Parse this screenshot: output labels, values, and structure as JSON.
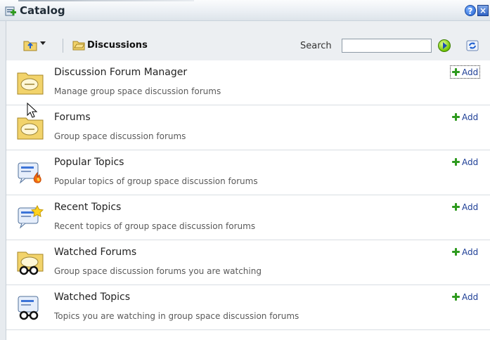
{
  "window": {
    "title": "Catalog",
    "help_icon": "help-icon",
    "close_icon": "close-icon",
    "help_glyph": "?",
    "close_glyph": "×"
  },
  "toolbar": {
    "breadcrumb": "Discussions",
    "search_label": "Search",
    "search_value": "",
    "search_placeholder": ""
  },
  "items": [
    {
      "title": "Discussion Forum Manager",
      "description": "Manage group space discussion forums",
      "add_label": "Add",
      "icon": "folder-discussion-icon"
    },
    {
      "title": "Forums",
      "description": "Group space discussion forums",
      "add_label": "Add",
      "icon": "folder-discussion-icon"
    },
    {
      "title": "Popular Topics",
      "description": "Popular topics of group space discussion forums",
      "add_label": "Add",
      "icon": "popular-topics-icon"
    },
    {
      "title": "Recent Topics",
      "description": "Recent topics of group space discussion forums",
      "add_label": "Add",
      "icon": "recent-topics-icon"
    },
    {
      "title": "Watched Forums",
      "description": "Group space discussion forums you are watching",
      "add_label": "Add",
      "icon": "watched-forums-icon"
    },
    {
      "title": "Watched Topics",
      "description": "Topics you are watching in group space discussion forums",
      "add_label": "Add",
      "icon": "watched-topics-icon"
    }
  ],
  "colors": {
    "add_plus": "#2e9a1e",
    "link": "#1d3e96",
    "folder": "#f2d36b"
  }
}
